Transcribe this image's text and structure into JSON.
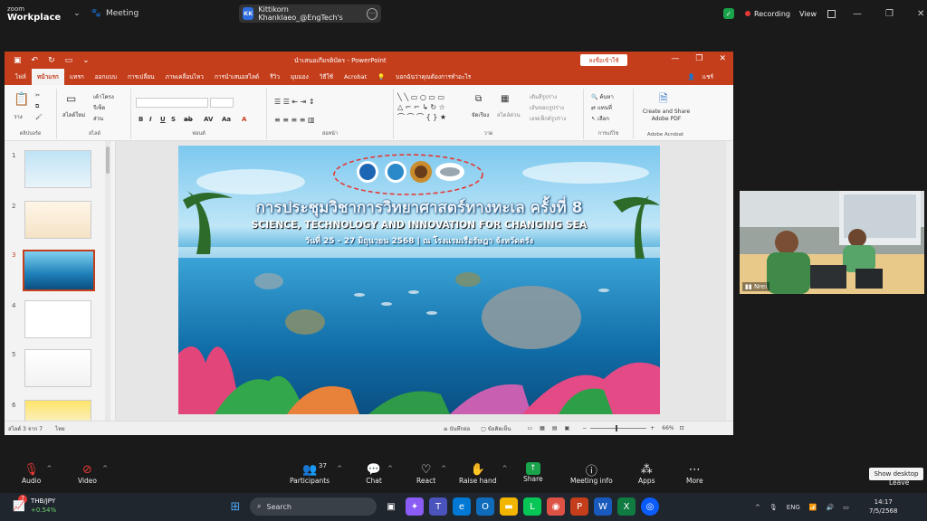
{
  "zoom": {
    "brand_small": "zoom",
    "brand_big": "Workplace",
    "meeting_label": "Meeting",
    "sharer_initials": "KK",
    "sharer_text": "Kittikorn Khanklaeo_@EngTech's",
    "recording_label": "Recording",
    "view_label": "View"
  },
  "ppt": {
    "title": "นำเสนอเกียรติบัตร  -  PowerPoint",
    "signin_label": "ลงชื่อเข้าใช้",
    "tabs": [
      "ไฟล์",
      "หน้าแรก",
      "แทรก",
      "ออกแบบ",
      "การเปลี่ยน",
      "ภาพเคลื่อนไหว",
      "การนำเสนอสไลด์",
      "รีวิว",
      "มุมมอง",
      "วิธีใช้",
      "Acrobat",
      "บอกฉันว่าคุณต้องการทำอะไร"
    ],
    "user_label": "แชร์",
    "groups": [
      "คลิปบอร์ด",
      "สไลด์",
      "ฟอนต์",
      "ย่อหน้า",
      "วาด",
      "การแก้ไข",
      "Adobe Acrobat"
    ],
    "ribbon_items": {
      "paste": "วาง",
      "new_slide": "สไลด์ใหม่",
      "layout": "เค้าโครง",
      "reset": "รีเซ็ต",
      "section": "ส่วน",
      "arrange": "จัดเรียง",
      "quick_styles": "สไตล์ด่วน",
      "shape_fill": "เติมสีรูปร่าง",
      "shape_outline": "เส้นขอบรูปร่าง",
      "shape_effects": "เอฟเฟ็กต์รูปร่าง",
      "find": "ค้นหา",
      "replace": "แทนที่",
      "select": "เลือก",
      "adobe": "Create and Share Adobe PDF"
    },
    "thumbnails": [
      "1",
      "2",
      "3",
      "4",
      "5",
      "6"
    ],
    "selected_slide": "3",
    "status_left": "สไลด์ 3 จาก 7",
    "status_lang": "ไทย",
    "status_notes": "บันทึกย่อ",
    "status_comments": "ข้อคิดเห็น",
    "zoom_level": "66%"
  },
  "slide": {
    "title_th": "การประชุมวิชาการวิทยาศาสตร์ทางทะเล  ครั้งที่ 8",
    "title_en": "SCIENCE, TECHNOLOGY AND INNOVATION FOR CHANGING SEA",
    "subtitle": "วันที่ 25 - 27 มิถุนายน 2568 | ณ โรงแรมเรือรัษฎา จังหวัดตรัง"
  },
  "video": {
    "participant_name": "Nrei"
  },
  "controls": {
    "audio": "Audio",
    "video": "Video",
    "participants": "Participants",
    "participants_count": "37",
    "chat": "Chat",
    "react": "React",
    "raise_hand": "Raise hand",
    "share": "Share",
    "meeting_info": "Meeting info",
    "apps": "Apps",
    "more": "More",
    "leave": "Leave",
    "tooltip": "Show desktop"
  },
  "taskbar": {
    "weather_badge": "7",
    "weather_title": "THB/JPY",
    "weather_change": "+0.54%",
    "search_placeholder": "Search",
    "language": "ENG",
    "time": "14:17",
    "date": "7/5/2568"
  },
  "colors": {
    "ppt_accent": "#c43e1c",
    "zoom_bg": "#1a1a1a",
    "recording_dot": "#e53935",
    "share_green": "#19a34a"
  }
}
